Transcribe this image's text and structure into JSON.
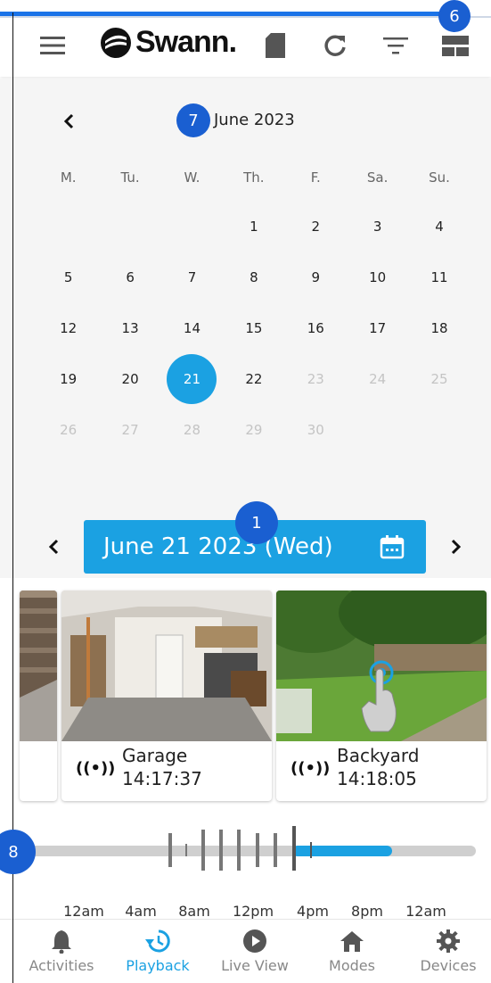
{
  "app": {
    "brand": "Swann."
  },
  "colors": {
    "accent": "#1ba1e2",
    "badge": "#1a5fd1",
    "disabled": "#c4c4c4"
  },
  "header": {
    "icons": [
      "menu-icon",
      "sd-card-icon",
      "refresh-icon",
      "filter-icon",
      "layout-icon"
    ]
  },
  "calendar": {
    "month_title": "June 2023",
    "weekdays": [
      "M.",
      "Tu.",
      "W.",
      "Th.",
      "F.",
      "Sa.",
      "Su."
    ],
    "days": [
      {
        "label": "",
        "state": "empty"
      },
      {
        "label": "",
        "state": "empty"
      },
      {
        "label": "",
        "state": "empty"
      },
      {
        "label": "1",
        "state": "normal"
      },
      {
        "label": "2",
        "state": "normal"
      },
      {
        "label": "3",
        "state": "normal"
      },
      {
        "label": "4",
        "state": "normal"
      },
      {
        "label": "5",
        "state": "normal"
      },
      {
        "label": "6",
        "state": "normal"
      },
      {
        "label": "7",
        "state": "normal"
      },
      {
        "label": "8",
        "state": "normal"
      },
      {
        "label": "9",
        "state": "normal"
      },
      {
        "label": "10",
        "state": "normal"
      },
      {
        "label": "11",
        "state": "normal"
      },
      {
        "label": "12",
        "state": "normal"
      },
      {
        "label": "13",
        "state": "normal"
      },
      {
        "label": "14",
        "state": "normal"
      },
      {
        "label": "15",
        "state": "normal"
      },
      {
        "label": "16",
        "state": "normal"
      },
      {
        "label": "17",
        "state": "normal"
      },
      {
        "label": "18",
        "state": "normal"
      },
      {
        "label": "19",
        "state": "normal"
      },
      {
        "label": "20",
        "state": "normal"
      },
      {
        "label": "21",
        "state": "selected"
      },
      {
        "label": "22",
        "state": "normal"
      },
      {
        "label": "23",
        "state": "disabled"
      },
      {
        "label": "24",
        "state": "disabled"
      },
      {
        "label": "25",
        "state": "disabled"
      },
      {
        "label": "26",
        "state": "disabled"
      },
      {
        "label": "27",
        "state": "disabled"
      },
      {
        "label": "28",
        "state": "disabled"
      },
      {
        "label": "29",
        "state": "disabled"
      },
      {
        "label": "30",
        "state": "disabled"
      }
    ]
  },
  "badges": {
    "b1": "1",
    "b6": "6",
    "b7": "7",
    "b8": "8"
  },
  "date_nav": {
    "label": "June 21 2023 (Wed)"
  },
  "cameras": [
    {
      "name": "Garage",
      "time": "14:17:37",
      "signal": "((•))"
    },
    {
      "name": "Backyard",
      "time": "14:18:05",
      "signal": "((•))"
    }
  ],
  "timeline": {
    "hour_labels": [
      "12am",
      "4am",
      "8am",
      "12pm",
      "4pm",
      "8pm",
      "12am"
    ]
  },
  "bottom_nav": [
    {
      "label": "Activities",
      "icon": "bell-icon",
      "active": false
    },
    {
      "label": "Playback",
      "icon": "history-icon",
      "active": true
    },
    {
      "label": "Live View",
      "icon": "play-icon",
      "active": false
    },
    {
      "label": "Modes",
      "icon": "home-icon",
      "active": false
    },
    {
      "label": "Devices",
      "icon": "gear-icon",
      "active": false
    }
  ]
}
